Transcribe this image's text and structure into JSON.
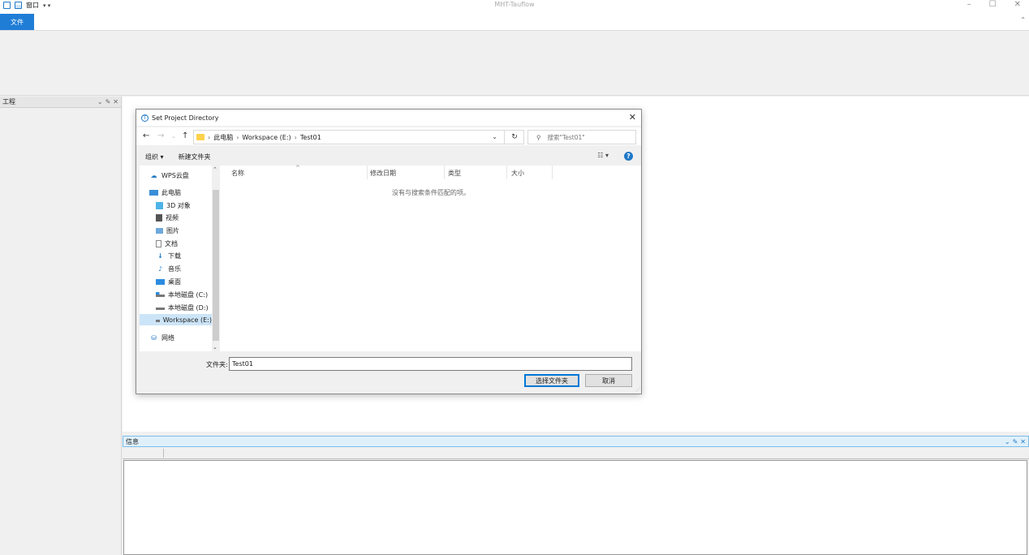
{
  "app": {
    "title": "MHT-Tauflow",
    "qat_menu": "窗口",
    "qat_arrow": "▾ ▾"
  },
  "ribbon": {
    "file_tab": "文件"
  },
  "left_panel": {
    "title": "工程"
  },
  "info_panel": {
    "title": "信息"
  },
  "dialog": {
    "title": "Set Project Directory",
    "breadcrumbs": [
      "此电脑",
      "Workspace (E:)",
      "Test01"
    ],
    "search_placeholder": "搜索\"Test01\"",
    "commands": {
      "organize": "组织 ▾",
      "new_folder": "新建文件夹"
    },
    "nav_items": [
      {
        "label": "WPS云盘"
      },
      {
        "label": "此电脑"
      },
      {
        "label": "3D 对象"
      },
      {
        "label": "视频"
      },
      {
        "label": "图片"
      },
      {
        "label": "文档"
      },
      {
        "label": "下载"
      },
      {
        "label": "音乐"
      },
      {
        "label": "桌面"
      },
      {
        "label": "本地磁盘 (C:)"
      },
      {
        "label": "本地磁盘 (D:)"
      },
      {
        "label": "Workspace (E:)"
      },
      {
        "label": "网络"
      }
    ],
    "columns": [
      "名称",
      "修改日期",
      "类型",
      "大小"
    ],
    "empty_message": "没有与搜索条件匹配的项。",
    "folder_label": "文件夹:",
    "folder_value": "Test01",
    "select_button": "选择文件夹",
    "cancel_button": "取消"
  },
  "colors": {
    "accent": "#1f7dd6",
    "selection": "#cce4f7",
    "info_header": "#dff0fb"
  }
}
